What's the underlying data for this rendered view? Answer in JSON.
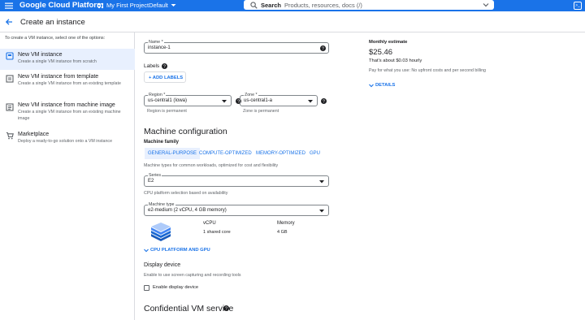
{
  "topbar": {
    "brand": "Google Cloud Platform",
    "project": "My First ProjectDefault",
    "search_label": "Search",
    "search_placeholder": "Products, resources, docs (/)"
  },
  "header": {
    "title": "Create an instance"
  },
  "sidebar": {
    "intro": "To create a VM instance, select one of the options:",
    "options": [
      {
        "title": "New VM instance",
        "desc": "Create a single VM instance from scratch"
      },
      {
        "title": "New VM instance from template",
        "desc": "Create a single VM instance from an existing template"
      },
      {
        "title": "New VM instance from machine image",
        "desc": "Create a single VM instance from an existing machine image"
      },
      {
        "title": "Marketplace",
        "desc": "Deploy a ready-to-go solution onto a VM instance"
      }
    ]
  },
  "form": {
    "name_label": "Name *",
    "name_value": "instance-1",
    "labels_heading": "Labels",
    "add_labels": "+ ADD LABELS",
    "region_label": "Region *",
    "region_value": "us-central1 (Iowa)",
    "region_hint": "Region is permanent",
    "zone_label": "Zone *",
    "zone_value": "us-central1-a",
    "zone_hint": "Zone is permanent",
    "machine_config_title": "Machine configuration",
    "machine_family_label": "Machine family",
    "tabs": [
      "GENERAL-PURPOSE",
      "COMPUTE-OPTIMIZED",
      "MEMORY-OPTIMIZED",
      "GPU"
    ],
    "family_desc": "Machine types for common workloads, optimized for cost and flexibility",
    "series_label": "Series",
    "series_value": "E2",
    "series_hint": "CPU platform selection based on availability",
    "machine_type_label": "Machine type",
    "machine_type_value": "e2-medium (2 vCPU, 4 GB memory)",
    "vcpu_header": "vCPU",
    "vcpu_value": "1 shared core",
    "memory_header": "Memory",
    "memory_value": "4 GB",
    "cpu_platform_link": "CPU PLATFORM AND GPU",
    "display_device_title": "Display device",
    "display_device_desc": "Enable to use screen capturing and recording tools",
    "enable_display": "Enable display device",
    "confidential_title": "Confidential VM service"
  },
  "estimate": {
    "title": "Monthly estimate",
    "price": "$25.46",
    "hourly": "That's about $0.03 hourly",
    "note": "Pay for what you use: No upfront costs and per second billing",
    "details": "DETAILS"
  },
  "colors": {
    "accent": "#1a73e8",
    "selected_bg": "#e8f0fe"
  }
}
